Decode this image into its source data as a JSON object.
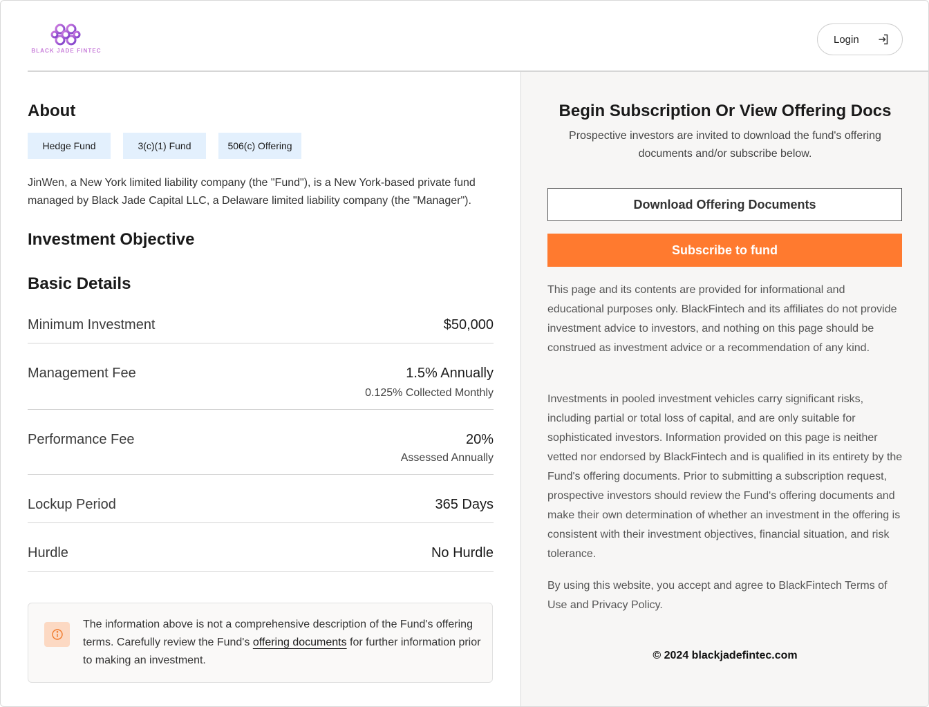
{
  "header": {
    "logo_text": "BLACK JADE FINTEC",
    "login_label": "Login"
  },
  "about": {
    "heading": "About",
    "tags": [
      "Hedge Fund",
      "3(c)(1) Fund",
      "506(c) Offering"
    ],
    "description": "JinWen, a New York limited liability company (the \"Fund\"), is a New York-based private fund managed by Black Jade Capital LLC, a Delaware limited liability company (the \"Manager\")."
  },
  "investment_objective": {
    "heading": "Investment Objective"
  },
  "basic_details": {
    "heading": "Basic Details",
    "rows": [
      {
        "label": "Minimum Investment",
        "value": "$50,000",
        "sub": ""
      },
      {
        "label": "Management Fee",
        "value": "1.5% Annually",
        "sub": "0.125% Collected Monthly"
      },
      {
        "label": "Performance Fee",
        "value": "20%",
        "sub": "Assessed Annually"
      },
      {
        "label": "Lockup Period",
        "value": "365 Days",
        "sub": ""
      },
      {
        "label": "Hurdle",
        "value": "No Hurdle",
        "sub": ""
      }
    ]
  },
  "notice": {
    "text_before": "The information above is not a comprehensive description of the Fund's offering terms. Carefully review the Fund's ",
    "link_text": "offering documents",
    "text_after": " for further information prior to making an investment."
  },
  "subscription": {
    "title": "Begin Subscription Or View Offering Docs",
    "subtitle": "Prospective investors are invited to download the fund's offering documents and/or subscribe below.",
    "download_label": "Download Offering Documents",
    "subscribe_label": "Subscribe to fund",
    "disclaimers": [
      "This page and its contents are provided for informational and educational purposes only. BlackFintech and its affiliates do not provide investment advice to investors, and nothing on this page should be construed as investment advice or a recommendation of any kind.",
      "Investments in pooled investment vehicles carry significant risks, including partial or total loss of capital, and are only suitable for sophisticated investors. Information provided on this page is neither vetted nor endorsed by BlackFintech and is qualified in its entirety by the Fund's offering documents. Prior to submitting a subscription request, prospective investors should review the Fund's offering documents and make their own determination of whether an investment in the offering is consistent with their investment objectives, financial situation, and risk tolerance.",
      "By using this website, you accept and agree to BlackFintech Terms of Use and Privacy Policy."
    ],
    "copyright": "© 2024 blackjadefintec.com"
  },
  "colors": {
    "accent_orange": "#ff7a2f",
    "tag_background": "#e3f0fd",
    "logo_purple": "#a86bd8",
    "right_panel_bg": "#f7f6f5"
  },
  "icons": {
    "logo": "knot-logo-icon",
    "login": "sign-in-icon",
    "notice": "info-circle-icon"
  }
}
